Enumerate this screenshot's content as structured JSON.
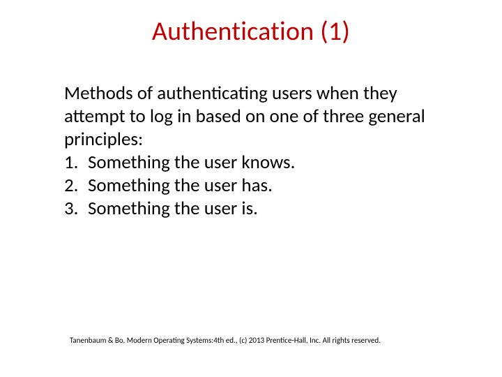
{
  "title": "Authentication (1)",
  "body": {
    "intro": "Methods of authenticating users when they attempt to log in based on one of three general principles:",
    "items": [
      {
        "num": "1.",
        "text": "Something the user knows."
      },
      {
        "num": "2.",
        "text": "Something the user has."
      },
      {
        "num": "3.",
        "text": "Something the user is."
      }
    ]
  },
  "footer": "Tanenbaum & Bo, Modern Operating Systems:4th ed., (c) 2013 Prentice-Hall, Inc. All rights reserved."
}
